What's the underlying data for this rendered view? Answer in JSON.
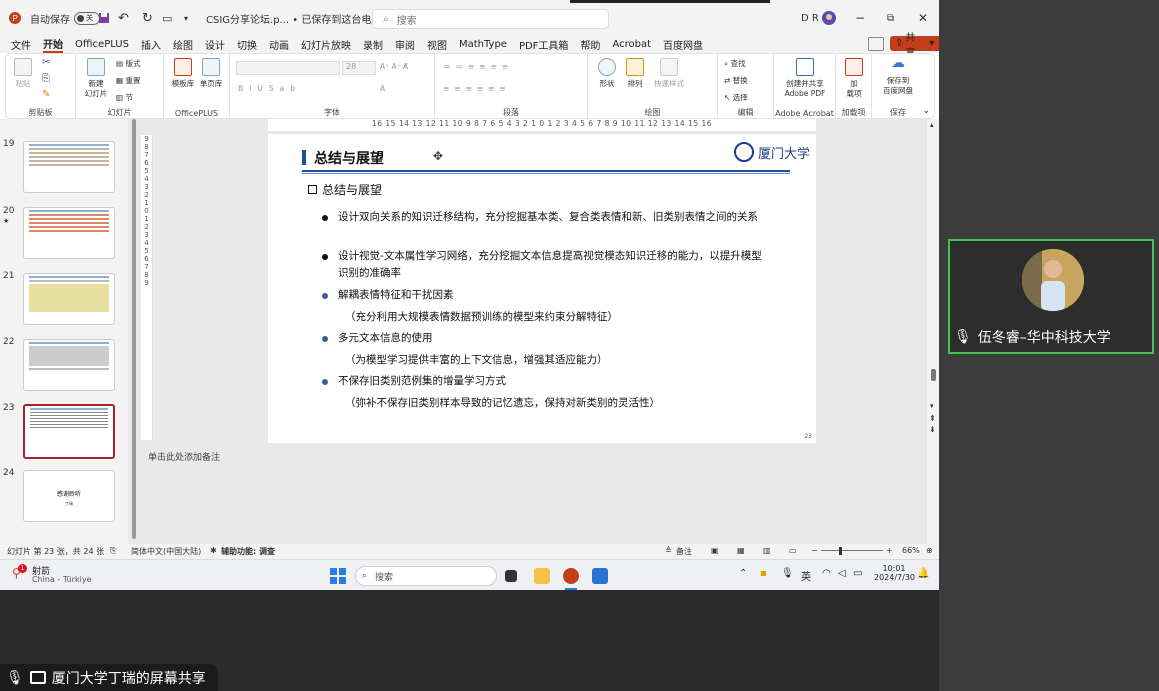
{
  "titlebar": {
    "autosave_label": "自动保存",
    "autosave_state": "关",
    "doc_title": "CSIG分享论坛.p... • 已保存到这台电脑",
    "search_placeholder": "搜索",
    "user_initials": "D R"
  },
  "menu": [
    "文件",
    "开始",
    "OfficePLUS",
    "插入",
    "绘图",
    "设计",
    "切换",
    "动画",
    "幻灯片放映",
    "录制",
    "审阅",
    "视图",
    "MathType",
    "PDF工具箱",
    "帮助",
    "Acrobat",
    "百度网盘"
  ],
  "share_button": "共享",
  "ribbon": {
    "groups": {
      "clipboard": "剪贴板",
      "slides": "幻灯片",
      "officeplus": "OfficePLUS",
      "font": "字体",
      "paragraph": "段落",
      "drawing": "绘图",
      "editing": "编辑",
      "adobe": "Adobe Acrobat",
      "addins": "加载项",
      "save": "保存"
    },
    "paste": "粘贴",
    "new_slide": "新建\n幻灯片",
    "layout": "版式",
    "reset": "重置",
    "section": "节",
    "template": "模板库",
    "single_page": "单页库",
    "font_size": "28",
    "shape": "形状",
    "arrange": "排列",
    "quick_style": "快速样式",
    "find": "查找",
    "replace": "替换",
    "select": "选择",
    "create_pdf": "创建并共享\nAdobe PDF",
    "addin": "加\n载项",
    "save_baidu": "保存到\n百度网盘"
  },
  "ruler": "16 15 14 13 12 11 10 9 8 7 6 5 4 3 2 1 0 1 2 3 4 5 6 7 8 9 10 11 12 13 14 15 16",
  "vruler": [
    "9",
    "8",
    "7",
    "6",
    "5",
    "4",
    "3",
    "2",
    "1",
    "0",
    "1",
    "2",
    "3",
    "4",
    "5",
    "6",
    "7",
    "8",
    "9"
  ],
  "thumbnails": [
    "19",
    "20",
    "21",
    "22",
    "23",
    "24"
  ],
  "thumb24": {
    "line1": "感谢聆听",
    "line2": "丁瑞"
  },
  "slide": {
    "title": "总结与展望",
    "logo_text": "厦门大学",
    "subtitle": "总结与展望",
    "bullets": [
      {
        "text": "设计双向关系的知识迁移结构，充分挖掘基本类、复合类表情和新、旧类别表情之间的关系",
        "note": ""
      },
      {
        "text": "设计视觉-文本属性学习网络，充分挖掘文本信息提高视觉模态知识迁移的能力，以提升模型识别的准确率",
        "note": ""
      },
      {
        "text": "解耦表情特征和干扰因素",
        "note": "（充分利用大规模表情数据预训练的模型来约束分解特征）"
      },
      {
        "text": "多元文本信息的使用",
        "note": "（为模型学习提供丰富的上下文信息，增强其适应能力）"
      },
      {
        "text": "不保存旧类别范例集的增量学习方式",
        "note": "（弥补不保存旧类别样本导致的记忆遗忘，保持对新类别的灵活性）"
      }
    ],
    "page_number": "23"
  },
  "notes_placeholder": "单击此处添加备注",
  "status": {
    "slide_info": "幻灯片 第 23 张，共 24 张",
    "language": "简体中文(中国大陆)",
    "accessibility": "辅助功能: 调查",
    "notes": "备注",
    "zoom": "66%"
  },
  "taskbar": {
    "weather_title": "射箭",
    "weather_sub": "China - Türkiye",
    "search": "搜索",
    "ime": "英",
    "time": "10:01",
    "date": "2024/7/30",
    "badge": "1"
  },
  "video": {
    "speaker": "伍冬睿–华中科技大学"
  },
  "share_label": "厦门大学丁瑞的屏幕共享",
  "colors": {
    "accent": "#c43e1c",
    "slide_blue": "#1f4e9a",
    "speaking_border": "#3cc650"
  }
}
